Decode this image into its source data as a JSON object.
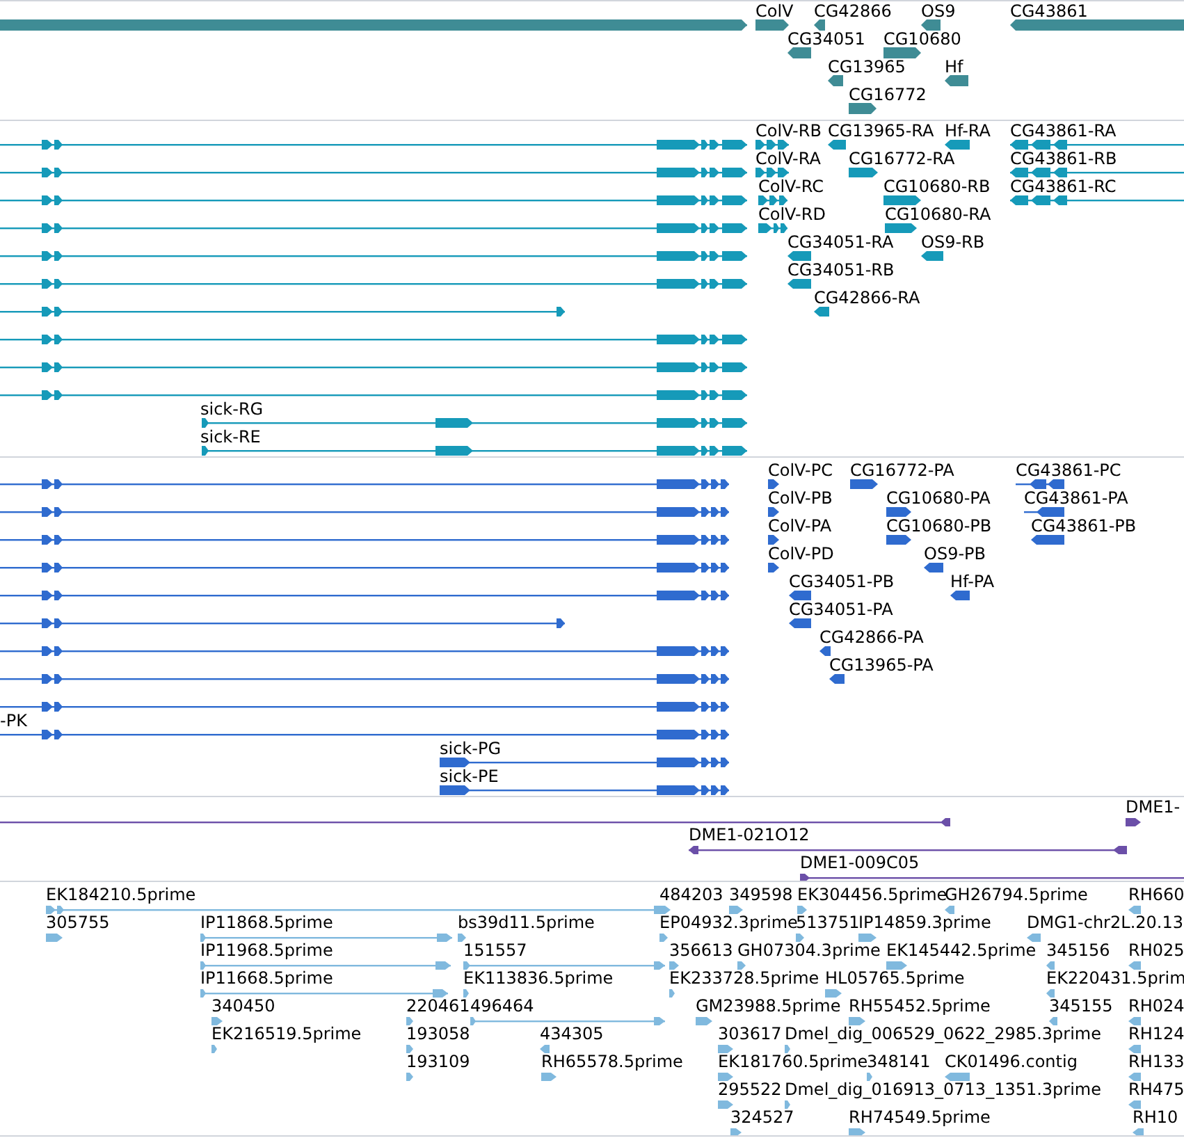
{
  "tracks": [
    {
      "kind": "gene",
      "color": "#3f8c95",
      "features": [
        {
          "reverse": false
        },
        {
          "label": "ColV",
          "reverse": false
        },
        {
          "label": "CG42866",
          "reverse": true
        },
        {
          "label": "OS9",
          "reverse": true
        },
        {
          "label": "CG43861",
          "reverse": true
        },
        {
          "label": "CG34051",
          "reverse": true
        },
        {
          "label": "CG10680",
          "reverse": false
        },
        {
          "label": "CG13965",
          "reverse": true
        },
        {
          "label": "Hf",
          "reverse": true
        },
        {
          "label": "CG16772",
          "reverse": false
        }
      ]
    },
    {
      "kind": "mrna",
      "color": "#169ab9",
      "features": [
        {
          "reverse": false
        },
        {
          "reverse": false
        },
        {
          "reverse": false
        },
        {
          "reverse": false
        },
        {
          "reverse": false
        },
        {
          "reverse": false
        },
        {
          "reverse": false
        },
        {
          "reverse": false
        },
        {
          "reverse": false
        },
        {
          "reverse": false
        },
        {
          "label": "sick-RG",
          "reverse": false
        },
        {
          "label": "sick-RE",
          "reverse": false
        },
        {
          "label": "ColV-RB",
          "reverse": false
        },
        {
          "label": "CG13965-RA",
          "reverse": true
        },
        {
          "label": "Hf-RA",
          "reverse": true
        },
        {
          "label": "CG43861-RA",
          "reverse": true
        },
        {
          "label": "ColV-RA",
          "reverse": false
        },
        {
          "label": "CG16772-RA",
          "reverse": false
        },
        {
          "label": "CG43861-RB",
          "reverse": true
        },
        {
          "label": "ColV-RC",
          "reverse": false
        },
        {
          "label": "CG10680-RB",
          "reverse": false
        },
        {
          "label": "CG43861-RC",
          "reverse": true
        },
        {
          "label": "ColV-RD",
          "reverse": false
        },
        {
          "label": "CG10680-RA",
          "reverse": false
        },
        {
          "label": "CG34051-RA",
          "reverse": true
        },
        {
          "label": "OS9-RB",
          "reverse": true
        },
        {
          "label": "CG34051-RB",
          "reverse": true
        },
        {
          "label": "CG42866-RA",
          "reverse": true
        }
      ]
    },
    {
      "kind": "protein",
      "color": "#2f6bcf",
      "features": [
        {
          "reverse": false
        },
        {
          "reverse": false
        },
        {
          "reverse": false
        },
        {
          "reverse": false
        },
        {
          "reverse": false
        },
        {
          "reverse": false
        },
        {
          "reverse": false
        },
        {
          "reverse": false
        },
        {
          "reverse": false
        },
        {
          "label": "-PK",
          "reverse": false
        },
        {
          "label": "sick-PG",
          "reverse": false
        },
        {
          "label": "sick-PE",
          "reverse": false
        },
        {
          "label": "ColV-PC",
          "reverse": false
        },
        {
          "label": "CG16772-PA",
          "reverse": false
        },
        {
          "label": "CG43861-PC",
          "reverse": true
        },
        {
          "label": "ColV-PB",
          "reverse": false
        },
        {
          "label": "CG10680-PA",
          "reverse": false
        },
        {
          "label": "CG43861-PA",
          "reverse": true
        },
        {
          "label": "ColV-PA",
          "reverse": false
        },
        {
          "label": "CG10680-PB",
          "reverse": false
        },
        {
          "label": "CG43861-PB",
          "reverse": true
        },
        {
          "label": "ColV-PD",
          "reverse": false
        },
        {
          "label": "OS9-PB",
          "reverse": true
        },
        {
          "label": "CG34051-PB",
          "reverse": true
        },
        {
          "label": "Hf-PA",
          "reverse": true
        },
        {
          "label": "CG34051-PA",
          "reverse": true
        },
        {
          "label": "CG42866-PA",
          "reverse": true
        },
        {
          "label": "CG13965-PA",
          "reverse": true
        }
      ]
    },
    {
      "kind": "clone",
      "color": "#6b4fa8",
      "features": [
        {
          "reverse": true
        },
        {
          "label": "DME1-",
          "reverse": false
        },
        {
          "label": "DME1-021O12",
          "reverse": true
        },
        {
          "label": "DME1-009C05",
          "reverse": false
        }
      ]
    },
    {
      "kind": "est",
      "color": "#80b9de",
      "features": [
        {
          "label": "EK184210.5prime",
          "reverse": false
        },
        {
          "label": "484203",
          "reverse": false
        },
        {
          "label": "349598",
          "reverse": false
        },
        {
          "label": "EK304456.5prime",
          "reverse": false
        },
        {
          "label": "GH26794.5prime",
          "reverse": true
        },
        {
          "label": "RH660",
          "reverse": true
        },
        {
          "label": "305755",
          "reverse": false
        },
        {
          "label": "IP11868.5prime",
          "reverse": false
        },
        {
          "label": "bs39d11.5prime",
          "reverse": false
        },
        {
          "label": "EP04932.3prime",
          "reverse": false
        },
        {
          "label": "513751",
          "reverse": false
        },
        {
          "label": "IP14859.3prime",
          "reverse": false
        },
        {
          "label": "DMG1-chr2L.20.13",
          "reverse": true
        },
        {
          "label": "IP11968.5prime",
          "reverse": false
        },
        {
          "label": "151557",
          "reverse": false
        },
        {
          "label": "356613",
          "reverse": false
        },
        {
          "label": "GH07304.3prime",
          "reverse": false
        },
        {
          "label": "EK145442.5prime",
          "reverse": false
        },
        {
          "label": "345156",
          "reverse": true
        },
        {
          "label": "RH025",
          "reverse": true
        },
        {
          "label": "IP11668.5prime",
          "reverse": false
        },
        {
          "label": "EK113836.5prime",
          "reverse": false
        },
        {
          "label": "EK233728.5prime",
          "reverse": false
        },
        {
          "label": "HL05765.5prime",
          "reverse": false
        },
        {
          "label": "EK220431.5prim",
          "reverse": true
        },
        {
          "label": "340450",
          "reverse": false
        },
        {
          "label": "220461",
          "reverse": false
        },
        {
          "label": "496464",
          "reverse": false
        },
        {
          "label": "GM23988.5prime",
          "reverse": false
        },
        {
          "label": "RH55452.5prime",
          "reverse": false
        },
        {
          "label": "345155",
          "reverse": true
        },
        {
          "label": "RH024",
          "reverse": true
        },
        {
          "label": "EK216519.5prime",
          "reverse": false
        },
        {
          "label": "193058",
          "reverse": false
        },
        {
          "label": "434305",
          "reverse": true
        },
        {
          "label": "303617",
          "reverse": false
        },
        {
          "label": "Dmel_dig_006529_0622_2985.3prime",
          "reverse": false
        },
        {
          "label": "RH124",
          "reverse": true
        },
        {
          "label": "193109",
          "reverse": false
        },
        {
          "label": "RH65578.5prime",
          "reverse": false
        },
        {
          "label": "EK181760.5prime",
          "reverse": false
        },
        {
          "label": "348141",
          "reverse": false
        },
        {
          "label": "CK01496.contig",
          "reverse": true
        },
        {
          "label": "RH133",
          "reverse": true
        },
        {
          "label": "295522",
          "reverse": false
        },
        {
          "label": "Dmel_dig_016913_0713_1351.3prime",
          "reverse": false
        },
        {
          "label": "RH475",
          "reverse": true
        },
        {
          "label": "324527",
          "reverse": false
        },
        {
          "label": "RH74549.5prime",
          "reverse": false
        },
        {
          "label": "RH10",
          "reverse": true
        }
      ]
    }
  ]
}
